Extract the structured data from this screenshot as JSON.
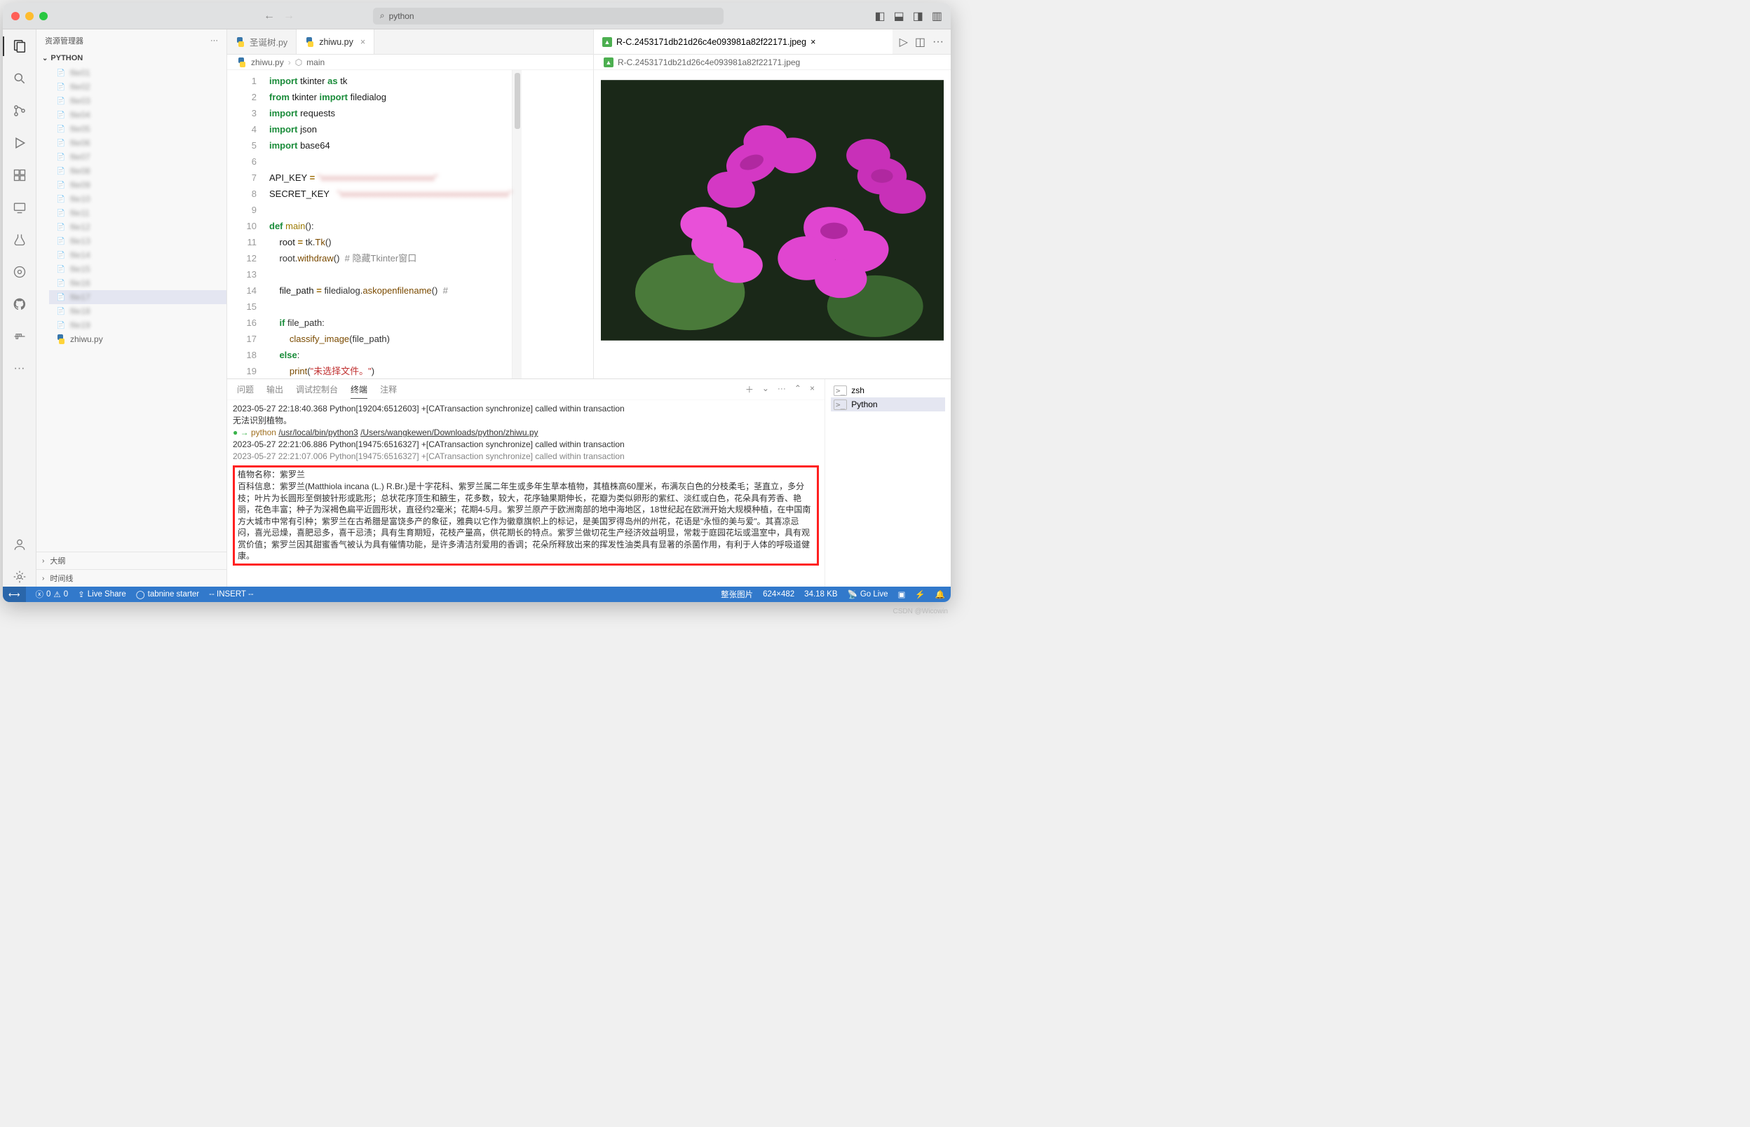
{
  "titlebar": {
    "search": "python"
  },
  "sidebar": {
    "title": "资源管理器",
    "root": "PYTHON",
    "items": [
      {
        "label": "file01",
        "blur": true
      },
      {
        "label": "file02",
        "blur": true
      },
      {
        "label": "file03",
        "blur": true
      },
      {
        "label": "file04",
        "blur": true
      },
      {
        "label": "file05",
        "blur": true
      },
      {
        "label": "file06",
        "blur": true
      },
      {
        "label": "file07",
        "blur": true
      },
      {
        "label": "file08",
        "blur": true
      },
      {
        "label": "file09",
        "blur": true
      },
      {
        "label": "file10",
        "blur": true
      },
      {
        "label": "file11",
        "blur": true
      },
      {
        "label": "file12",
        "blur": true
      },
      {
        "label": "file13",
        "blur": true
      },
      {
        "label": "file14",
        "blur": true
      },
      {
        "label": "file15",
        "blur": true
      },
      {
        "label": "file16",
        "blur": true
      },
      {
        "label": "file17",
        "blur": true,
        "selected": true
      },
      {
        "label": "file18",
        "blur": true
      },
      {
        "label": "file19",
        "blur": true
      },
      {
        "label": "zhiwu.py",
        "blur": false
      }
    ],
    "outline": "大纲",
    "timeline": "时间线"
  },
  "tabs": {
    "items": [
      {
        "label": "圣诞树.py",
        "active": false,
        "type": "py"
      },
      {
        "label": "zhiwu.py",
        "active": true,
        "type": "py",
        "closable": true
      }
    ]
  },
  "breadcrumb": {
    "file": "zhiwu.py",
    "symbol": "main"
  },
  "code": {
    "lines": [
      {
        "n": 1,
        "html": "<span class='kw'>import</span> <span class='mod'>tkinter</span> <span class='kw'>as</span> <span class='mod'>tk</span>"
      },
      {
        "n": 2,
        "html": "<span class='kw'>from</span> <span class='mod'>tkinter</span> <span class='kw'>import</span> <span class='mod'>filedialog</span>"
      },
      {
        "n": 3,
        "html": "<span class='kw'>import</span> <span class='mod'>requests</span>"
      },
      {
        "n": 4,
        "html": "<span class='kw'>import</span> <span class='mod'>json</span>"
      },
      {
        "n": 5,
        "html": "<span class='kw'>import</span> <span class='mod'>base64</span>"
      },
      {
        "n": 6,
        "html": ""
      },
      {
        "n": 7,
        "html": "<span class='name'>API_KEY</span> <span class='op'>=</span> <span class='blurred'>\"xxxxxxxxxxxxxxxxxxxxxxxxx\"</span>"
      },
      {
        "n": 8,
        "html": "<span class='name'>SECRET_KEY</span>   <span class='blurred'>\"xxxxxxxxxxxxxxxxxxxxxxxxxxxxxxxxxxxxx\"</span>"
      },
      {
        "n": 9,
        "html": ""
      },
      {
        "n": 10,
        "html": "<span class='kw'>def</span> <span class='def'>main</span>():"
      },
      {
        "n": 11,
        "html": "    <span class='name'>root</span> <span class='op'>=</span> tk.<span class='fn'>Tk</span>()"
      },
      {
        "n": 12,
        "html": "    root.<span class='fn'>withdraw</span>()  <span class='com'># 隐藏Tkinter窗口</span>"
      },
      {
        "n": 13,
        "html": ""
      },
      {
        "n": 14,
        "html": "    <span class='name'>file_path</span> <span class='op'>=</span> filedialog.<span class='fn'>askopenfilename</span>()  <span class='com'>#</span>"
      },
      {
        "n": 15,
        "html": ""
      },
      {
        "n": 16,
        "html": "    <span class='kw'>if</span> file_path:"
      },
      {
        "n": 17,
        "html": "        <span class='fn'>classify_image</span>(file_path)"
      },
      {
        "n": 18,
        "html": "    <span class='kw'>else</span>:"
      },
      {
        "n": 19,
        "html": "        <span class='fn'>print</span>(<span class='str'>\"未选择文件。\"</span>)"
      }
    ]
  },
  "preview": {
    "filename": "R-C.2453171db21d26c4e093981a82f22171.jpeg"
  },
  "panel": {
    "tabs": [
      "问题",
      "输出",
      "调试控制台",
      "终端",
      "注释"
    ],
    "active_tab_index": 3,
    "terminal": {
      "line1": "2023-05-27 22:18:40.368 Python[19204:6512603] +[CATransaction synchronize] called within transaction",
      "line2": "无法识别植物。",
      "prompt_prefix": "→  ",
      "prompt_cmd": "python",
      "prompt_path1": "/usr/local/bin/python3",
      "prompt_path2": "/Users/wangkewen/Downloads/python/zhiwu.py",
      "line3": "2023-05-27 22:21:06.886 Python[19475:6516327] +[CATransaction synchronize] called within transaction",
      "line4": "2023-05-27 22:21:07.006 Python[19475:6516327] +[CATransaction synchronize] called within transaction",
      "result_title": "植物名称：紫罗兰",
      "result_body": "百科信息：紫罗兰(Matthiola incana (L.) R.Br.)是十字花科、紫罗兰属二年生或多年生草本植物，其植株高60厘米，布满灰白色的分枝柔毛；茎直立，多分枝；叶片为长圆形至倒披针形或匙形；总状花序顶生和腋生，花多数，较大，花序轴果期伸长，花瓣为类似卵形的紫红、淡红或白色，花朵具有芳香、艳丽，花色丰富；种子为深褐色扁平近圆形状，直径约2毫米；花期4-5月。紫罗兰原产于欧洲南部的地中海地区，18世纪起在欧洲开始大规模种植，在中国南方大城市中常有引种；紫罗兰在古希腊是富饶多产的象征，雅典以它作为徽章旗帜上的标记，是美国罗得岛州的州花，花语是\"永恒的美与爱\"。其喜凉忌闷，喜光忌燥，喜肥忌多，喜干忌渍；具有生育期短，花枝产量高，供花期长的特点。紫罗兰做切花生产经济效益明显，常栽于庭园花坛或温室中，具有观赏价值；紫罗兰因其甜蜜香气被认为具有催情功能，是许多清洁剂爱用的香调；花朵所释放出来的挥发性油类具有显著的杀菌作用，有利于人体的呼吸道健康。"
    },
    "side": [
      {
        "label": "zsh",
        "active": false
      },
      {
        "label": "Python",
        "active": true
      }
    ]
  },
  "statusbar": {
    "errors": "0",
    "warnings": "0",
    "liveshare": "Live Share",
    "tabnine": "tabnine starter",
    "mode": "-- INSERT --",
    "image_label": "整张图片",
    "image_dims": "624×482",
    "image_size": "34.18 KB",
    "golive": "Go Live"
  },
  "watermark": "CSDN @Wicowin"
}
